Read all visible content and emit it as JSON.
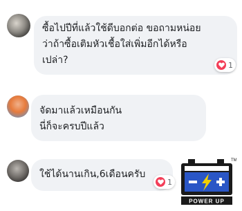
{
  "comments": [
    {
      "lines": [
        "ซื้อไปปีที่แล้วใช้ดีบอกต่อ  ขอถามหน่อย",
        "ว่าถ้าซื้อเติมหัวเชื้อใส่เพิ่มอีกได้หรือ",
        "เปล่า?"
      ],
      "reaction": {
        "icon": "heart-icon",
        "count": "1"
      }
    },
    {
      "lines": [
        "จัดมาแล้วเหมือนกัน",
        "นี่ก็จะครบปีแล้ว"
      ]
    },
    {
      "lines": [
        "ใช้ได้นานเกิน,6เดือนครับ"
      ],
      "reaction": {
        "icon": "heart-icon",
        "count": "1"
      }
    }
  ],
  "brand": {
    "text": "POWER UP",
    "tm": "TM",
    "minus": "−",
    "plus": "+",
    "colors": {
      "battery": "#1a1a1a",
      "panel": "#2a56c6",
      "accent": "#f5d000"
    }
  }
}
